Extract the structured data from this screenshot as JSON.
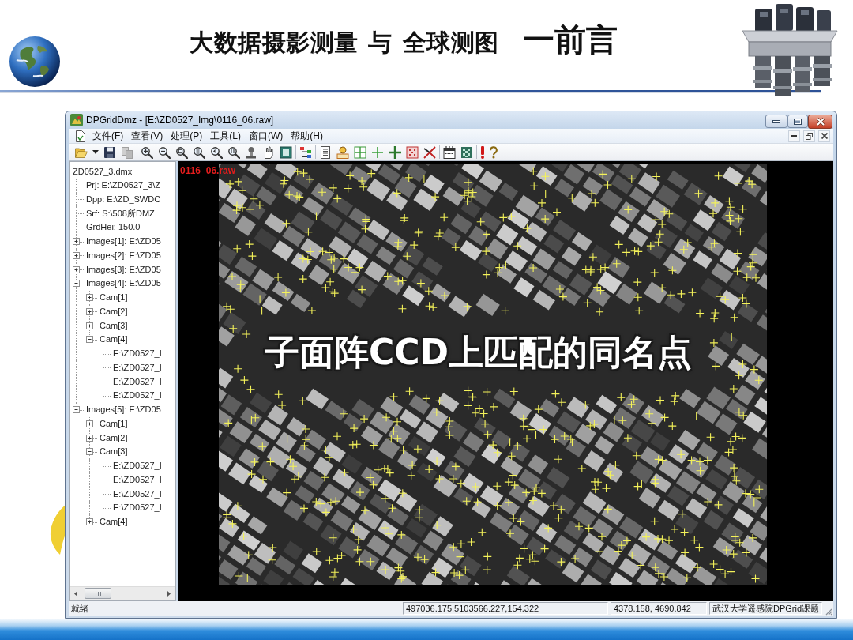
{
  "slide": {
    "title": "大数据摄影测量 与 全球测图",
    "section": "一前言"
  },
  "window": {
    "title": "DPGridDmz - [E:\\ZD0527_Img\\0116_06.raw]"
  },
  "menu": [
    "文件(F)",
    "查看(V)",
    "处理(P)",
    "工具(L)",
    "窗口(W)",
    "帮助(H)"
  ],
  "tree": {
    "items": [
      {
        "label": "ZD0527_3.dmx",
        "kind": "root",
        "children": [
          {
            "label": "Prj: E:\\ZD0527_3\\Z",
            "kind": "leaf"
          },
          {
            "label": "Dpp: E:\\ZD_SWDC",
            "kind": "leaf"
          },
          {
            "label": "Srf: S:\\508所DMZ",
            "kind": "leaf"
          },
          {
            "label": "GrdHei: 150.0",
            "kind": "leaf"
          },
          {
            "label": "Images[1]: E:\\ZD05",
            "kind": "group",
            "expanded": false
          },
          {
            "label": "Images[2]: E:\\ZD05",
            "kind": "group",
            "expanded": false
          },
          {
            "label": "Images[3]: E:\\ZD05",
            "kind": "group",
            "expanded": false
          },
          {
            "label": "Images[4]: E:\\ZD05",
            "kind": "group",
            "expanded": true,
            "children": [
              {
                "label": "Cam[1]",
                "kind": "group",
                "expanded": false
              },
              {
                "label": "Cam[2]",
                "kind": "group",
                "expanded": false
              },
              {
                "label": "Cam[3]",
                "kind": "group",
                "expanded": false
              },
              {
                "label": "Cam[4]",
                "kind": "group",
                "expanded": true,
                "children": [
                  {
                    "label": "E:\\ZD0527_I",
                    "kind": "leaf"
                  },
                  {
                    "label": "E:\\ZD0527_I",
                    "kind": "leaf"
                  },
                  {
                    "label": "E:\\ZD0527_I",
                    "kind": "leaf"
                  },
                  {
                    "label": "E:\\ZD0527_I",
                    "kind": "leaf"
                  }
                ]
              }
            ]
          },
          {
            "label": "Images[5]: E:\\ZD05",
            "kind": "group",
            "expanded": true,
            "children": [
              {
                "label": "Cam[1]",
                "kind": "group",
                "expanded": false
              },
              {
                "label": "Cam[2]",
                "kind": "group",
                "expanded": false
              },
              {
                "label": "Cam[3]",
                "kind": "group",
                "expanded": true,
                "children": [
                  {
                    "label": "E:\\ZD0527_I",
                    "kind": "leaf"
                  },
                  {
                    "label": "E:\\ZD0527_I",
                    "kind": "leaf"
                  },
                  {
                    "label": "E:\\ZD0527_I",
                    "kind": "leaf"
                  },
                  {
                    "label": "E:\\ZD0527_I",
                    "kind": "leaf"
                  }
                ]
              },
              {
                "label": "Cam[4]",
                "kind": "group",
                "expanded": false
              }
            ]
          }
        ]
      }
    ]
  },
  "image_view": {
    "file_label": "0116_06.raw",
    "caption": "子面阵CCD上匹配的同名点"
  },
  "status_bar": {
    "message": "就绪",
    "fields": [
      "497036.175,5103566.227,154.322",
      "4378.158, 4690.842",
      "武汉大学遥感院DPGrid课题"
    ]
  }
}
